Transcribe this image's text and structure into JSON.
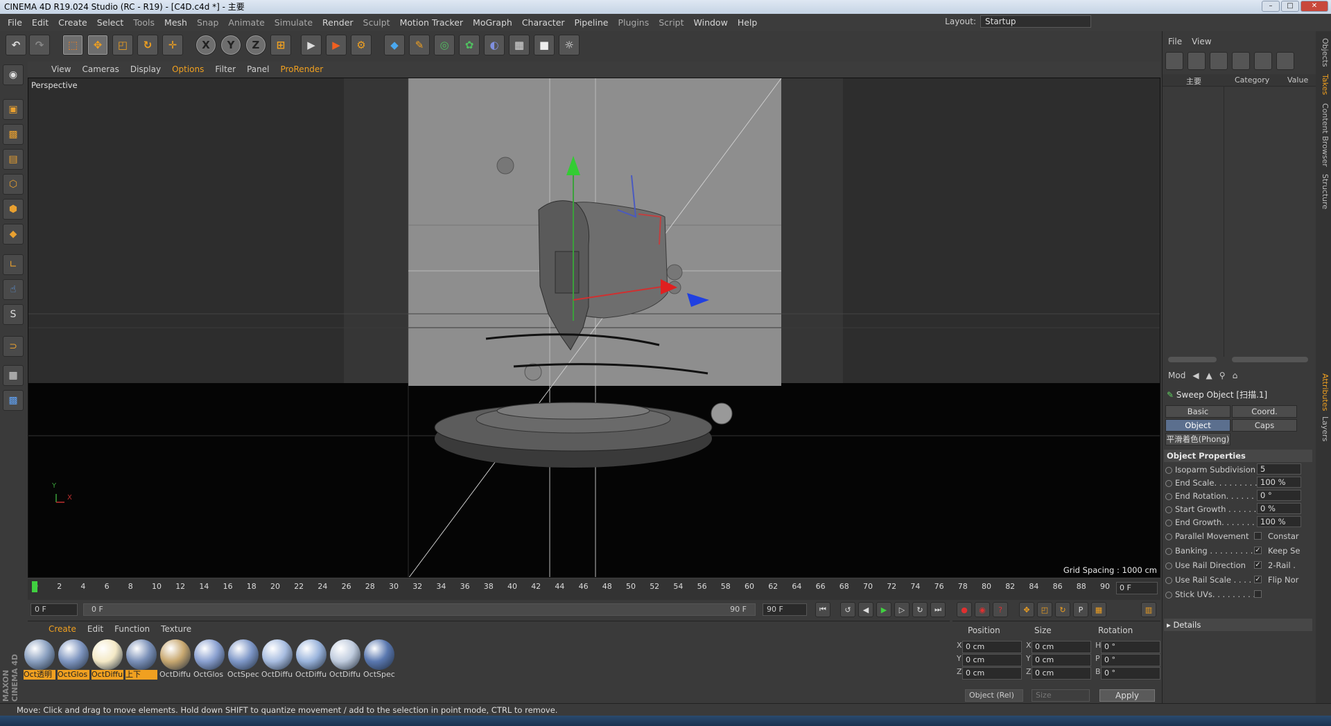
{
  "window": {
    "title": "CINEMA 4D R19.024 Studio (RC - R19) - [C4D.c4d *] - 主要"
  },
  "menubar": [
    "File",
    "Edit",
    "Create",
    "Select",
    "Tools",
    "Mesh",
    "Snap",
    "Animate",
    "Simulate",
    "Render",
    "Sculpt",
    "Motion Tracker",
    "MoGraph",
    "Character",
    "Pipeline",
    "Plugins",
    "Script",
    "Window",
    "Help"
  ],
  "layout": {
    "label": "Layout:",
    "value": "Startup"
  },
  "toolbar": {
    "axis_x": "X",
    "axis_y": "Y",
    "axis_z": "Z"
  },
  "viewport": {
    "menu": [
      "View",
      "Cameras",
      "Display",
      "Options",
      "Filter",
      "Panel",
      "ProRender"
    ],
    "camera": "Perspective",
    "grid_spacing": "Grid Spacing : 1000 cm",
    "axis_y": "Y",
    "axis_x": "X"
  },
  "timeline": {
    "ticks": [
      "0",
      "2",
      "4",
      "6",
      "8",
      "10",
      "12",
      "14",
      "16",
      "18",
      "20",
      "22",
      "24",
      "26",
      "28",
      "30",
      "32",
      "34",
      "36",
      "38",
      "40",
      "42",
      "44",
      "46",
      "48",
      "50",
      "52",
      "54",
      "56",
      "58",
      "60",
      "62",
      "64",
      "66",
      "68",
      "70",
      "72",
      "74",
      "76",
      "78",
      "80",
      "82",
      "84",
      "86",
      "88",
      "90"
    ],
    "current": "0 F"
  },
  "transport": {
    "start": "0 F",
    "range_start": "0 F",
    "range_end": "90 F",
    "end": "90 F"
  },
  "materials": {
    "menu": [
      "Create",
      "Edit",
      "Function",
      "Texture"
    ],
    "items": [
      {
        "label": "Oct透明",
        "color": "#8aa0c0",
        "hl": true
      },
      {
        "label": "OctGlos",
        "color": "#7f96c0",
        "hl": true
      },
      {
        "label": "OctDiffu",
        "color": "#f4e9c6",
        "hl": true
      },
      {
        "label": "上下",
        "color": "#7a90b8",
        "hl": true
      },
      {
        "label": "OctDiffu",
        "color": "#c8a870",
        "hl": false
      },
      {
        "label": "OctGlos",
        "color": "#8aa0d0",
        "hl": false
      },
      {
        "label": "OctSpec",
        "color": "#7f98c8",
        "hl": false
      },
      {
        "label": "OctDiffu",
        "color": "#a8bde0",
        "hl": false
      },
      {
        "label": "OctDiffu",
        "color": "#9ab4dc",
        "hl": false
      },
      {
        "label": "OctDiffu",
        "color": "#c0ccde",
        "hl": false
      },
      {
        "label": "OctSpec",
        "color": "#5a78b0",
        "hl": false
      }
    ]
  },
  "coords": {
    "headers": {
      "position": "Position",
      "size": "Size",
      "rotation": "Rotation"
    },
    "rows": [
      {
        "axis": "X",
        "pos": "0 cm",
        "saxis": "X",
        "size": "0 cm",
        "raxis": "H",
        "rot": "0 °"
      },
      {
        "axis": "Y",
        "pos": "0 cm",
        "saxis": "Y",
        "size": "0 cm",
        "raxis": "P",
        "rot": "0 °"
      },
      {
        "axis": "Z",
        "pos": "0 cm",
        "saxis": "Z",
        "size": "0 cm",
        "raxis": "B",
        "rot": "0 °"
      }
    ],
    "mode": "Object (Rel)",
    "size_mode": "Size",
    "apply": "Apply"
  },
  "objects": {
    "menu": [
      "File",
      "View"
    ],
    "cols": {
      "name": "主要",
      "category": "Category",
      "value": "Value"
    }
  },
  "attributes": {
    "menu": "Mod",
    "title": "Sweep Object [扫描.1]",
    "tabs": [
      "Basic",
      "Coord.",
      "Object",
      "Caps"
    ],
    "phong": "平滑着色(Phong)",
    "section": "Object Properties",
    "props": [
      {
        "label": "Isoparm Subdivision",
        "value": "5"
      },
      {
        "label": "End Scale. . . . . . . . .",
        "value": "100 %"
      },
      {
        "label": "End Rotation. . . . . .",
        "value": "0 °"
      },
      {
        "label": "Start Growth . . . . . .",
        "value": "0 %"
      },
      {
        "label": "End Growth. . . . . . .",
        "value": "100 %"
      }
    ],
    "checks": [
      {
        "label": "Parallel Movement",
        "check": "",
        "side": "Constar"
      },
      {
        "label": "Banking . . . . . . . . . .",
        "check": "✓",
        "side": "Keep Se"
      },
      {
        "label": "Use Rail Direction",
        "check": "✓",
        "side": "2-Rail ."
      },
      {
        "label": "Use Rail Scale . . . .",
        "check": "✓",
        "side": "Flip Nor"
      },
      {
        "label": "Stick UVs. . . . . . . . .",
        "check": "",
        "side": ""
      }
    ],
    "details": "Details"
  },
  "sidetabs": [
    "Objects",
    "Takes",
    "Content Browser",
    "Structure",
    "Attributes",
    "Layers"
  ],
  "status": "Move: Click and drag to move elements. Hold down SHIFT to quantize movement / add to the selection in point mode, CTRL to remove."
}
